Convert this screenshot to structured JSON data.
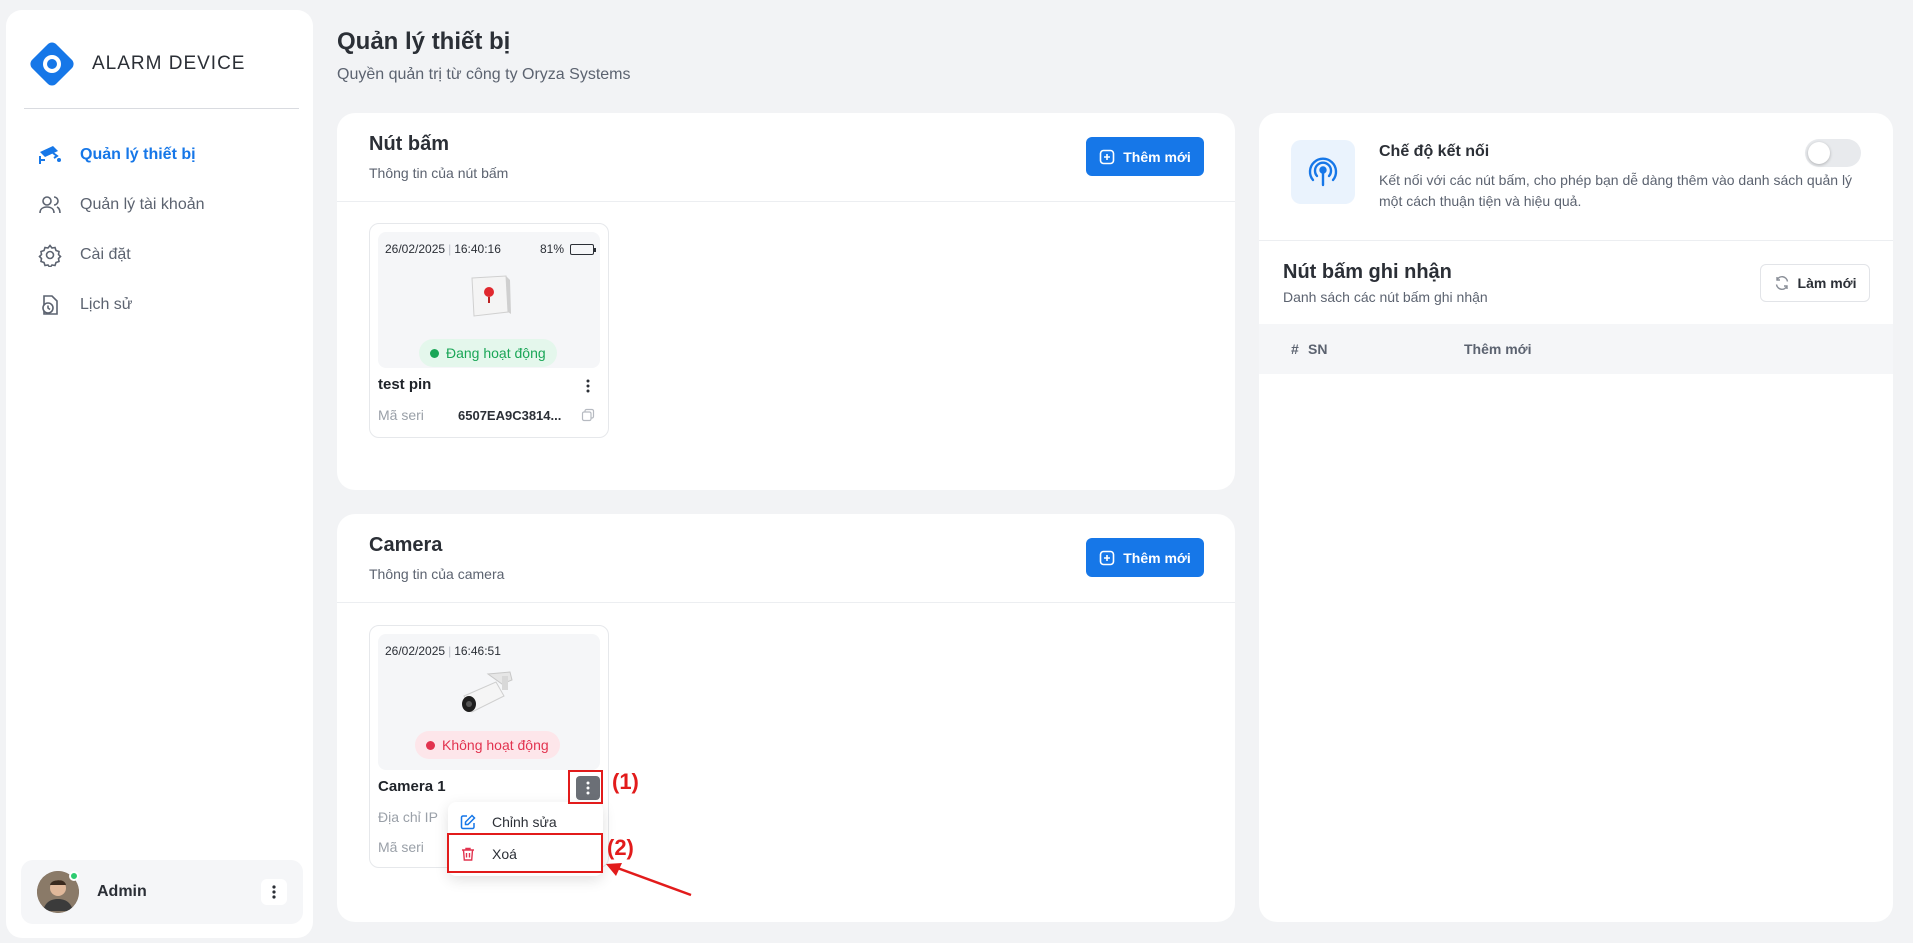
{
  "app": {
    "logo_text": "ALARM DEVICE",
    "brand_color": "#1677e8"
  },
  "sidebar": {
    "items": [
      {
        "label": "Quản lý thiết bị",
        "icon": "cctv-camera-icon",
        "active": true
      },
      {
        "label": "Quản lý tài khoản",
        "icon": "users-icon",
        "active": false
      },
      {
        "label": "Cài đặt",
        "icon": "gear-icon",
        "active": false
      },
      {
        "label": "Lịch sử",
        "icon": "history-icon",
        "active": false
      }
    ],
    "user": {
      "name": "Admin",
      "online": true
    }
  },
  "header": {
    "title": "Quản lý thiết bị",
    "subtitle": "Quyền quản trị từ công ty Oryza Systems"
  },
  "buttons_panel": {
    "title": "Nút bấm",
    "subtitle": "Thông tin của nút bấm",
    "add_label": "Thêm mới",
    "device": {
      "date": "26/02/2025",
      "time": "16:40:16",
      "battery": "81%",
      "battery_level": 0.81,
      "status": "Đang hoạt động",
      "name": "test pin",
      "serial_label": "Mã seri",
      "serial_value": "6507EA9C3814..."
    }
  },
  "camera_panel": {
    "title": "Camera",
    "subtitle": "Thông tin của camera",
    "add_label": "Thêm mới",
    "device": {
      "date": "26/02/2025",
      "time": "16:46:51",
      "status": "Không hoạt động",
      "name": "Camera 1",
      "ip_label": "Địa chỉ IP",
      "serial_label": "Mã seri"
    },
    "menu": {
      "edit_label": "Chỉnh sửa",
      "delete_label": "Xoá"
    }
  },
  "annotations": {
    "step1": "(1)",
    "step2": "(2)"
  },
  "connect_panel": {
    "title": "Chế độ kết nối",
    "description": "Kết nối với các nút bấm, cho phép bạn dễ dàng thêm vào danh sách quản lý một cách thuận tiện và hiệu quả.",
    "toggle_on": false
  },
  "recorded_panel": {
    "title": "Nút bấm ghi nhận",
    "subtitle": "Danh sách các nút bấm ghi nhận",
    "refresh_label": "Làm mới",
    "columns": [
      "#",
      "SN",
      "Thêm mới"
    ],
    "rows": []
  },
  "colors": {
    "active_status": "#1aa657",
    "inactive_status": "#e2334f",
    "annotation": "#e21b1b"
  }
}
